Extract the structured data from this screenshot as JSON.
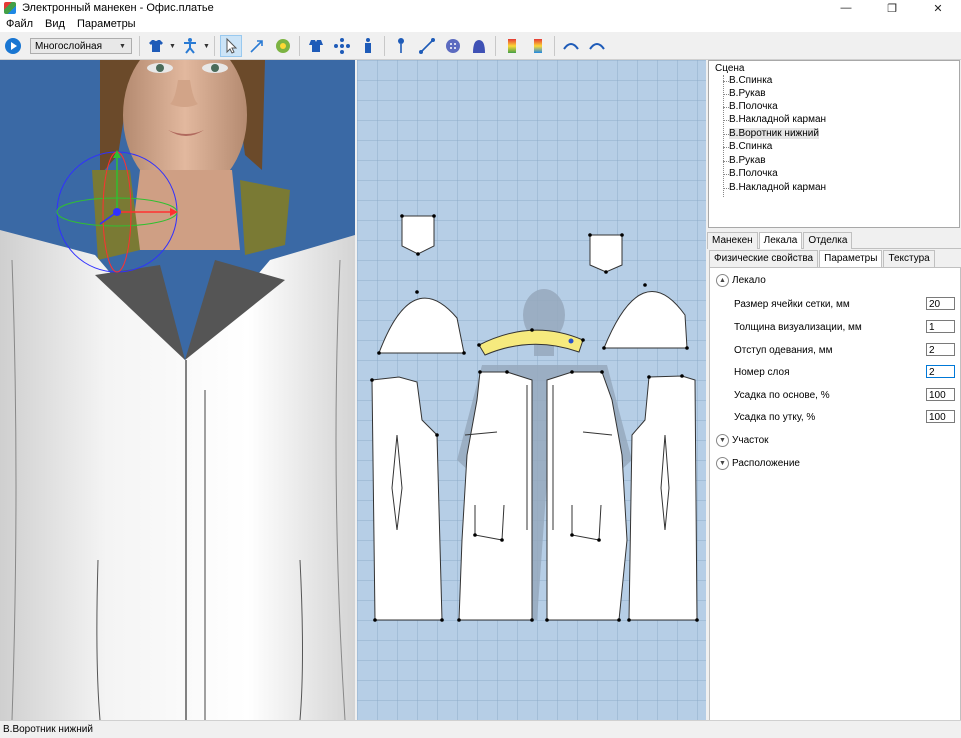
{
  "window": {
    "title": "Электронный манекен - Офис.платье",
    "minimize": "—",
    "restore": "❐",
    "close": "✕"
  },
  "menu": [
    "Файл",
    "Вид",
    "Параметры"
  ],
  "toolbar": {
    "mode": "Многослойная",
    "icons": [
      "play-icon",
      "shirt-icon",
      "mannequin-icon",
      "select-arrow-icon",
      "move-arrow-icon",
      "gear-flower-icon",
      "clothing-icon",
      "points-icon",
      "person-icon",
      "pin-icon",
      "ruler-icon",
      "button-icon",
      "hood-icon",
      "color-scale-icon",
      "color-scale-percent-icon",
      "undo-icon",
      "redo-icon"
    ]
  },
  "scene": {
    "root": "Сцена",
    "items": [
      "В.Спинка",
      "В.Рукав",
      "В.Полочка",
      "В.Накладной карман",
      "В.Воротник нижний",
      "В.Спинка",
      "В.Рукав",
      "В.Полочка",
      "В.Накладной карман"
    ],
    "selected_index": 4
  },
  "tabs_main": [
    "Манекен",
    "Лекала",
    "Отделка"
  ],
  "tabs_main_active": 1,
  "tabs_sub": [
    "Физические свойства",
    "Параметры",
    "Текстура"
  ],
  "tabs_sub_active": 1,
  "groups": {
    "lekalo": "Лекало",
    "uchastok": "Участок",
    "raspolozhenie": "Расположение"
  },
  "props": [
    {
      "label": "Размер ячейки сетки, мм",
      "value": "20"
    },
    {
      "label": "Толщина визуализации, мм",
      "value": "1"
    },
    {
      "label": "Отступ одевания, мм",
      "value": "2"
    },
    {
      "label": "Номер слоя",
      "value": "2"
    },
    {
      "label": "Усадка по основе, %",
      "value": "100"
    },
    {
      "label": "Усадка по утку, %",
      "value": "100"
    }
  ],
  "status": "В.Воротник нижний"
}
